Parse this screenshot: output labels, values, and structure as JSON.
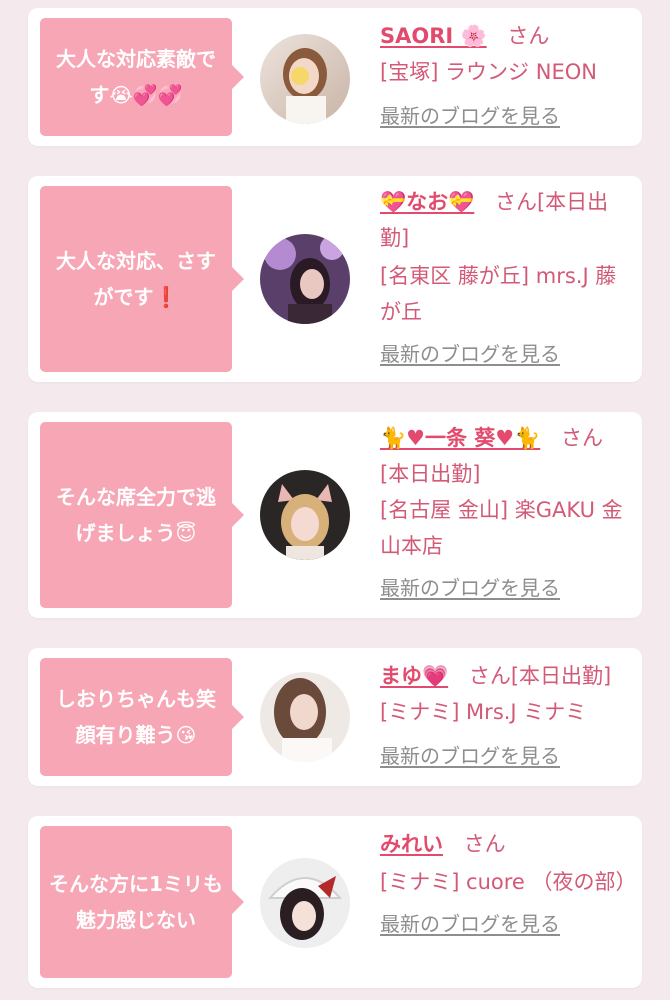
{
  "cards": [
    {
      "message": "大人な対応素敵です😭💞💞",
      "name": "SAORI 🌸",
      "honorific": "さん",
      "detail": "",
      "shop": "[宝塚] ラウンジ NEON",
      "blog_link": "最新のブログを見る"
    },
    {
      "message": "大人な対応、さすがです❗",
      "name": "💝なお💝",
      "honorific": "さん",
      "detail": "[本日出勤]",
      "shop": "[名東区 藤が丘] mrs.J 藤が丘",
      "blog_link": "最新のブログを見る"
    },
    {
      "message": "そんな席全力で逃げましょう😇",
      "name": "🐈♥一条 葵♥🐈",
      "honorific": "さん",
      "detail": "[本日出勤]",
      "shop": "[名古屋 金山] 楽GAKU 金山本店",
      "blog_link": "最新のブログを見る"
    },
    {
      "message": "しおりちゃんも笑顔有り難う😘",
      "name": "まゆ💗",
      "honorific": "さん",
      "detail": "[本日出勤]",
      "shop": "[ミナミ] Mrs.J ミナミ",
      "blog_link": "最新のブログを見る"
    },
    {
      "message": "そんな方に1ミリも魅力感じない",
      "name": "みれい",
      "honorific": "さん",
      "detail": "",
      "shop": "[ミナミ] cuore （夜の部）",
      "blog_link": "最新のブログを見る"
    }
  ],
  "colors": {
    "bubble": "#f7a6b6",
    "name": "#e24b6d",
    "text": "#d35a77",
    "link": "#8e8e8e",
    "background": "#f4eaee"
  }
}
